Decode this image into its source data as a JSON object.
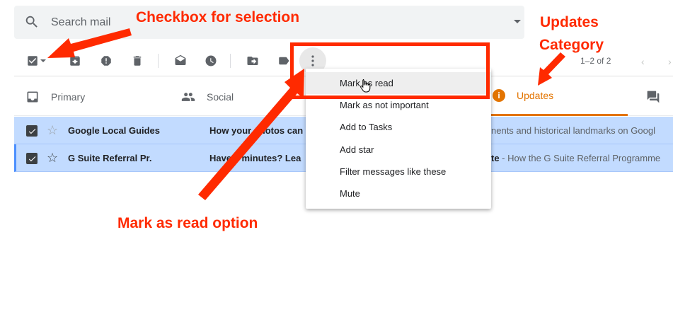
{
  "search": {
    "placeholder": "Search mail"
  },
  "toolbar": {
    "pager_text": "1–2 of 2",
    "prev_glyph": "‹",
    "next_glyph": "›"
  },
  "tabs": [
    {
      "label": "Primary",
      "icon": "inbox-icon"
    },
    {
      "label": "Social",
      "icon": "people-icon"
    },
    {
      "label": "Updates",
      "icon": "info-icon",
      "active": true
    }
  ],
  "mails": [
    {
      "sender": "Google Local Guides",
      "subject": "How your photos can",
      "snippet": "nents and historical landmarks on Googl",
      "checked": true,
      "starred": false
    },
    {
      "sender": "G Suite Referral Pr.",
      "subject": "Have 2 minutes? Lea",
      "snippet_bold": "te",
      "snippet": " - How the G Suite Referral Programme",
      "checked": true,
      "starred": false
    }
  ],
  "menu": {
    "items": [
      {
        "label": "Mark as read",
        "hover": true
      },
      {
        "label": "Mark as not important"
      },
      {
        "label": "Add to Tasks"
      },
      {
        "label": "Add star"
      },
      {
        "label": "Filter messages like these"
      },
      {
        "label": "Mute"
      }
    ]
  },
  "annotations": {
    "checkbox": "Checkbox for selection",
    "updates_line1": "Updates",
    "updates_line2": "Category",
    "mark_read": "Mark as read option",
    "color": "#ff2a00"
  },
  "colors": {
    "selected_row": "#c2dbff",
    "updates_accent": "#e37400"
  }
}
